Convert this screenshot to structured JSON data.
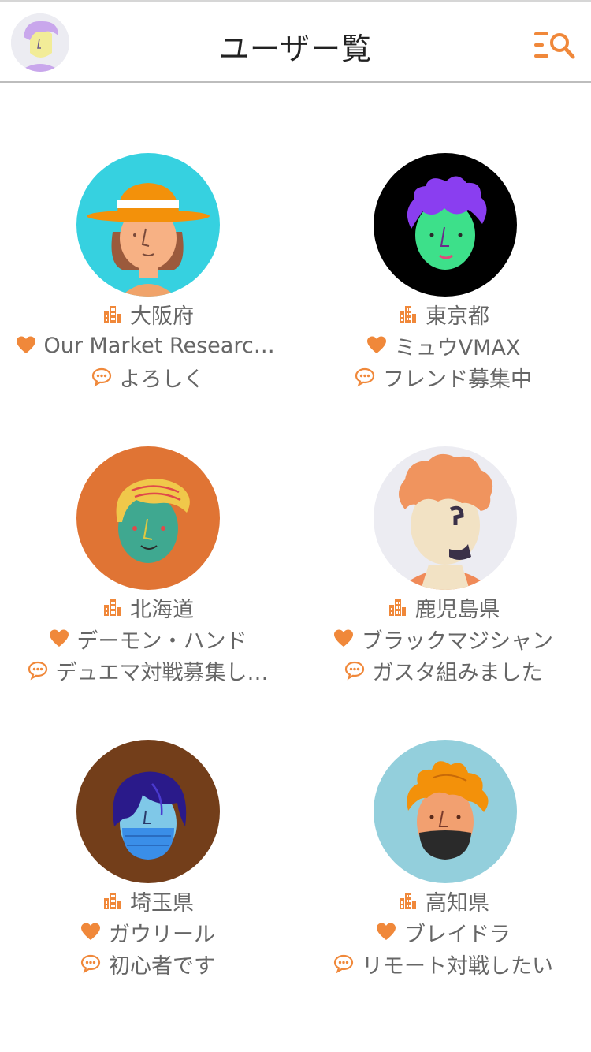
{
  "header": {
    "title": "ユーザー覧"
  },
  "users": [
    {
      "prefecture": "大阪府",
      "favorite": "Our Market Research…",
      "message": "よろしく"
    },
    {
      "prefecture": "東京都",
      "favorite": "ミュウVMAX",
      "message": "フレンド募集中"
    },
    {
      "prefecture": "北海道",
      "favorite": "デーモン・ハンド",
      "message": "デュエマ対戦募集し…"
    },
    {
      "prefecture": "鹿児島県",
      "favorite": "ブラックマジシャン",
      "message": "ガスタ組みました"
    },
    {
      "prefecture": "埼玉県",
      "favorite": "ガウリール",
      "message": "初心者です"
    },
    {
      "prefecture": "高知県",
      "favorite": "ブレイドラ",
      "message": "リモート対戦したい"
    }
  ],
  "colors": {
    "accent": "#f0883a",
    "text": "#666666",
    "title": "#222222"
  },
  "icons": {
    "location": "building-icon",
    "favorite": "heart-icon",
    "message": "speech-bubble-icon",
    "menu": "menu-search-icon"
  }
}
